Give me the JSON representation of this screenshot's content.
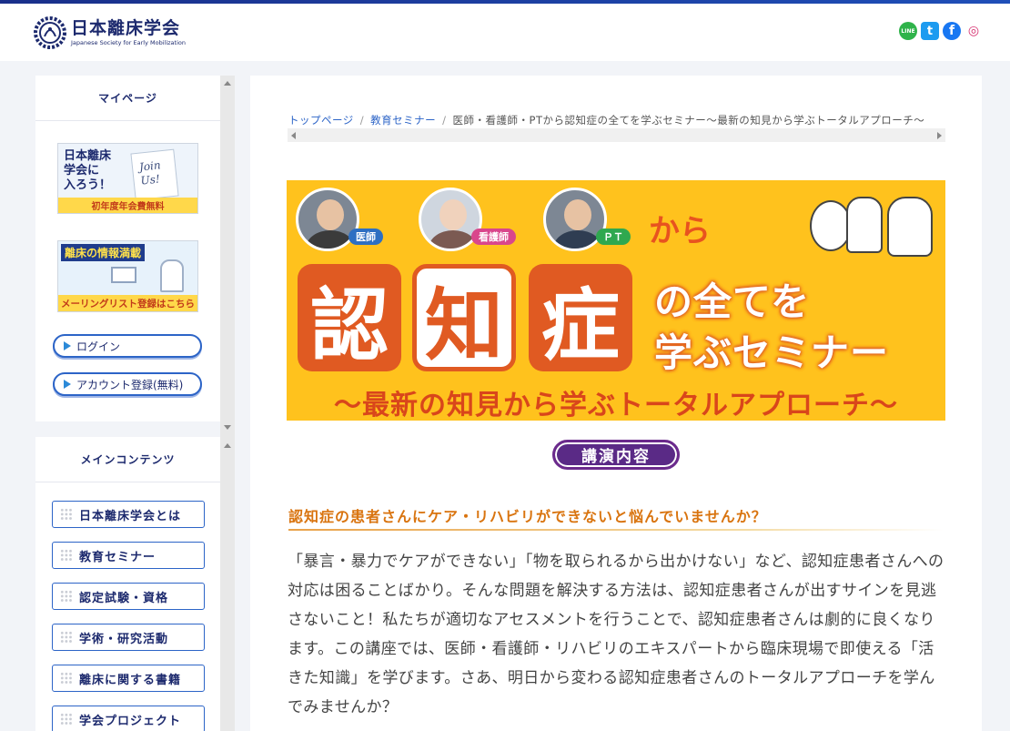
{
  "site": {
    "logo_jp": "日本離床学会",
    "logo_en": "Japanese Society for Early Mobilization",
    "social": [
      {
        "name": "line-icon",
        "color": "#2fb34a",
        "glyph": "LINE"
      },
      {
        "name": "twitter-icon",
        "color": "#1d9bf0",
        "glyph": "t"
      },
      {
        "name": "facebook-icon",
        "color": "#1877f2",
        "glyph": "f"
      },
      {
        "name": "instagram-icon",
        "color": "#d6306f",
        "glyph": "◎"
      }
    ]
  },
  "mypage": {
    "title": "マイページ",
    "join_banner": {
      "line1": "日本離床",
      "line2": "学会に",
      "line3": "入ろう！",
      "card": "Join Us!",
      "foot": "初年度年会費無料"
    },
    "mail_banner": {
      "title": "離床の情報満載",
      "foot": "メーリングリスト登録はこちら"
    },
    "login": "ログイン",
    "register": "アカウント登録(無料)"
  },
  "main_contents": {
    "title": "メインコンテンツ",
    "items": [
      "日本離床学会とは",
      "教育セミナー",
      "認定試験・資格",
      "学術・研究活動",
      "離床に関する書籍",
      "学会プロジェクト"
    ]
  },
  "breadcrumb": {
    "home": "トップページ",
    "section": "教育セミナー",
    "current": "医師・看護師・PTから認知症の全てを学ぶセミナー〜最新の知見から学ぶトータルアプローチ〜"
  },
  "hero": {
    "roles": [
      "医師",
      "看護師",
      "ＰＴ"
    ],
    "kara": "から",
    "big": [
      "認",
      "知",
      "症"
    ],
    "line1": "の全てを",
    "line2": "学ぶセミナー",
    "sub": "〜最新の知見から学ぶトータルアプローチ〜"
  },
  "koen_label": "講演内容",
  "section_heading": "認知症の患者さんにケア・リハビリができないと悩んでいませんか？",
  "paragraph": "「暴言・暴力でケアができない」「物を取られるから出かけない」など、認知症患者さんへの対応は困ることばかり。そんな問題を解決する方法は、認知症患者さんが出すサインを見逃さないこと！私たちが適切なアセスメントを行うことで、認知症患者さんは劇的に良くなります。この講座では、医師・看護師・リハビリのエキスパートから臨床現場で即使える「活きた知識」を学びます。さあ、明日から変わる認知症患者さんのトータルアプローチを学んでみませんか？"
}
